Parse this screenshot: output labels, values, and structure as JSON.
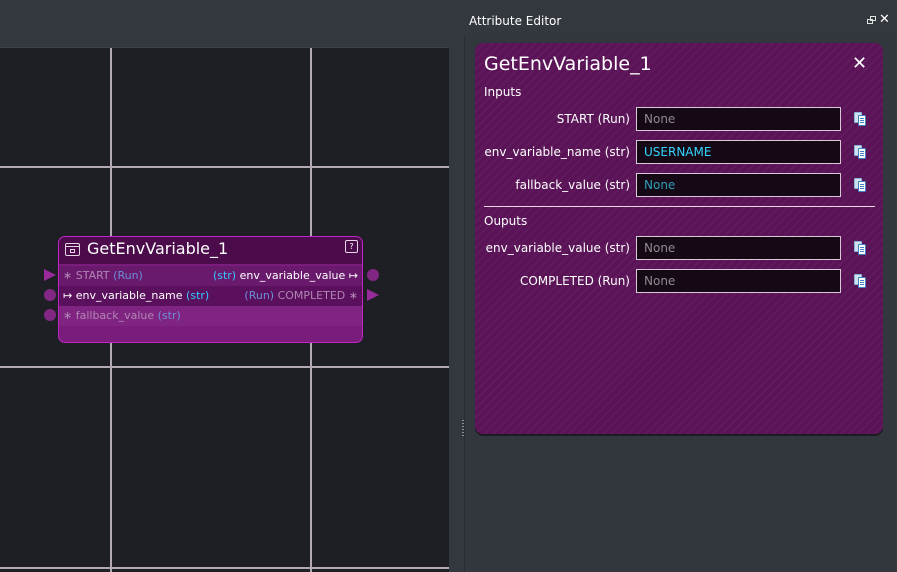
{
  "dock": {
    "title": "Attribute Editor",
    "close_glyph": "✕"
  },
  "node": {
    "title": "GetEnvVariable_1",
    "help_glyph": "?",
    "rows": [
      {
        "left_prefix": "∗ ",
        "left_name": "START",
        "left_type": "(Run)",
        "right_type": "(str)",
        "right_name": "env_variable_value",
        "right_suffix": " ↦"
      },
      {
        "left_prefix": "↦ ",
        "left_name": "env_variable_name",
        "left_type": "(str)",
        "right_type": "(Run)",
        "right_name": "COMPLETED",
        "right_suffix": " ∗"
      },
      {
        "left_prefix": "∗ ",
        "left_name": "fallback_value",
        "left_type": "(str)"
      }
    ]
  },
  "editor": {
    "title": "GetEnvVariable_1",
    "close_glyph": "✕",
    "inputs_label": "Inputs",
    "outputs_label": "Ouputs",
    "inputs": [
      {
        "label": "START (Run)",
        "value": "",
        "placeholder": "None"
      },
      {
        "label": "env_variable_name (str)",
        "value": "USERNAME",
        "placeholder": ""
      },
      {
        "label": "fallback_value (str)",
        "value": "",
        "placeholder": "None"
      }
    ],
    "outputs": [
      {
        "label": "env_variable_value (str)",
        "value": "",
        "placeholder": "None"
      },
      {
        "label": "COMPLETED (Run)",
        "value": "",
        "placeholder": "None"
      }
    ]
  },
  "colors": {
    "node_border": "#c026c2",
    "node_header": "#4c0c4c",
    "card_background": "#5a1357",
    "type_accent": "#35c6ff",
    "canvas_background": "#1e1f24"
  },
  "icons": {
    "node_icon": "window-icon",
    "copy_icon": "copy-icon",
    "float_icon": "float-window-icon"
  }
}
